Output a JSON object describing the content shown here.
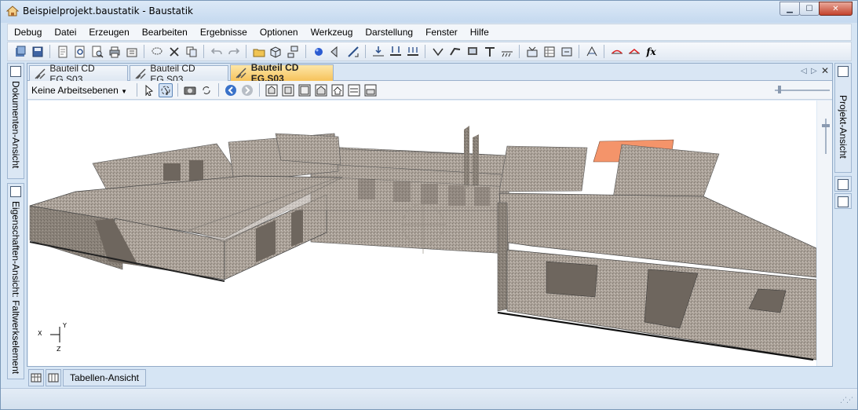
{
  "window": {
    "title": "Beispielprojekt.baustatik - Baustatik"
  },
  "menu": [
    "Debug",
    "Datei",
    "Erzeugen",
    "Bearbeiten",
    "Ergebnisse",
    "Optionen",
    "Werkzeug",
    "Darstellung",
    "Fenster",
    "Hilfe"
  ],
  "left_panel": {
    "tab1": "Dokumenten-Ansicht",
    "tab2": "Eigenschaften-Ansicht: Faltwerkselement"
  },
  "right_panel": {
    "tab1": "Projekt-Ansicht"
  },
  "doc_tabs": [
    {
      "label": "Bauteil CD EG.S03",
      "active": false
    },
    {
      "label": "Bauteil CD EG.S03",
      "active": false
    },
    {
      "label": "Bauteil CD EG.S03",
      "active": true
    }
  ],
  "view_toolbar": {
    "workplane_combo": "Keine Arbeitsebenen"
  },
  "axes": {
    "x": "X",
    "y": "Y",
    "z": "Z"
  },
  "bottom_tabs": {
    "table_view": "Tabellen-Ansicht"
  },
  "colors": {
    "highlight_wall": "#f4946a",
    "active_tab": "#f6c25b",
    "chrome": "#d6e5f4",
    "concrete": "#a89e94"
  }
}
